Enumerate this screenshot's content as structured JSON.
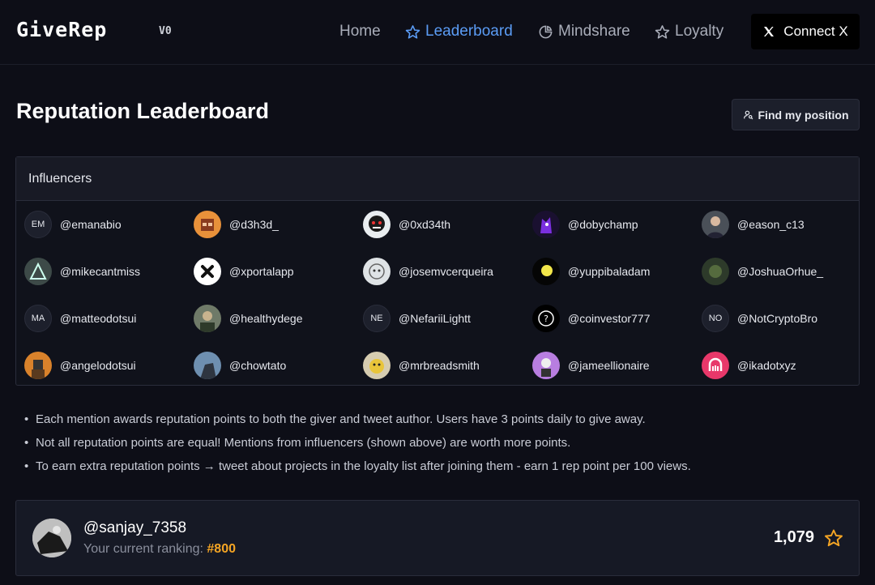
{
  "header": {
    "logo": "GiveRep",
    "version": "V0",
    "nav": [
      {
        "label": "Home",
        "icon": "none",
        "active": false
      },
      {
        "label": "Leaderboard",
        "icon": "star-icon",
        "active": true
      },
      {
        "label": "Mindshare",
        "icon": "pie-chart-icon",
        "active": false
      },
      {
        "label": "Loyalty",
        "icon": "star-icon",
        "active": false
      }
    ],
    "connect_label": "Connect X"
  },
  "page": {
    "title": "Reputation Leaderboard",
    "find_label": "Find my position"
  },
  "influencers": {
    "heading": "Influencers",
    "items": [
      {
        "handle": "@emanabio",
        "initials": "EM"
      },
      {
        "handle": "@d3h3d_"
      },
      {
        "handle": "@0xd34th"
      },
      {
        "handle": "@dobychamp"
      },
      {
        "handle": "@eason_c13"
      },
      {
        "handle": "@mikecantmiss"
      },
      {
        "handle": "@xportalapp"
      },
      {
        "handle": "@josemvcerqueira"
      },
      {
        "handle": "@yuppibaladam"
      },
      {
        "handle": "@JoshuaOrhue_"
      },
      {
        "handle": "@matteodotsui",
        "initials": "MA"
      },
      {
        "handle": "@healthydege"
      },
      {
        "handle": "@NefariiLightt",
        "initials": "NE"
      },
      {
        "handle": "@coinvestor777"
      },
      {
        "handle": "@NotCryptoBro",
        "initials": "NO"
      },
      {
        "handle": "@angelodotsui"
      },
      {
        "handle": "@chowtato"
      },
      {
        "handle": "@mrbreadsmith"
      },
      {
        "handle": "@jameellionaire"
      },
      {
        "handle": "@ikadotxyz"
      }
    ]
  },
  "info": {
    "bullets": [
      "Each mention awards reputation points to both the giver and tweet author. Users have 3 points daily to give away.",
      "Not all reputation points are equal! Mentions from influencers (shown above) are worth more points.",
      "To earn extra reputation points → tweet about projects in the loyalty list after joining them - earn 1 rep point per 100 views."
    ]
  },
  "user": {
    "handle": "@sanjay_7358",
    "rank_label": "Your current ranking:",
    "rank": "#800",
    "points": "1,079"
  },
  "colors": {
    "accent": "#5b9cf5",
    "rank": "#f5a524",
    "background": "#0d0e17"
  }
}
